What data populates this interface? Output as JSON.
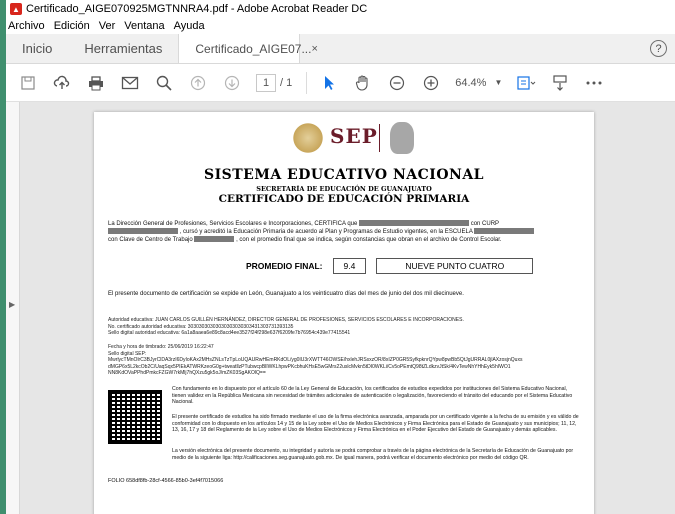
{
  "window": {
    "title": "Certificado_AIGE070925MGTNNRA4.pdf - Adobe Acrobat Reader DC",
    "app_icon": "acrobat-icon"
  },
  "menu": [
    "Archivo",
    "Edición",
    "Ver",
    "Ventana",
    "Ayuda"
  ],
  "tabs": {
    "home": "Inicio",
    "tools": "Herramientas",
    "document": "Certificado_AIGE07...",
    "close": "×",
    "help": "?"
  },
  "toolbar": {
    "icons": [
      "save-icon",
      "cloud-upload-icon",
      "print-icon",
      "email-icon",
      "search-zoom-icon",
      "page-up-icon",
      "page-down-icon",
      "select-arrow-icon",
      "hand-icon",
      "zoom-out-icon",
      "zoom-in-icon",
      "fit-page-icon",
      "scroll-mode-icon",
      "more-icon"
    ],
    "current_page": "1",
    "total_pages": "/ 1",
    "zoom": "64.4%"
  },
  "document": {
    "title": "SISTEMA EDUCATIVO NACIONAL",
    "subtitle": "SECRETARÍA DE EDUCACIÓN DE GUANAJUATO",
    "certificate_title": "CERTIFICADO DE EDUCACIÓN PRIMARIA",
    "logo_text": "SEP",
    "intro_1": "La Dirección General de Profesiones, Servicios Escolares e Incorporaciones, CERTIFICA que",
    "intro_1_end": "con CURP",
    "intro_2": ", cursó y acreditó la Educación Primaria de acuerdo al Plan y Programas de Estudio vigentes, en la ESCUELA",
    "intro_3a": "con Clave de Centro de Trabajo",
    "intro_3b": ", con el promedio final que se indica, según constancias que obran en el archivo de Control Escolar.",
    "promedio_label": "PROMEDIO FINAL:",
    "promedio_value": "9.4",
    "promedio_words": "NUEVE PUNTO CUATRO",
    "issued": "El presente documento de certificación se expide en León, Guanajuato a los veinticuatro días del mes de junio del dos mil diecinueve.",
    "authority_1": "Autoridad educativa: JUAN CARLOS GUILLÉN HERNÁNDEZ, DIRECTOR GENERAL DE PROFESIONES, SERVICIOS ESCOLARES E INCORPORACIONES.",
    "authority_2": "No. certificado autoridad educativa: 30303030303030303030303431303731393135",
    "authority_3": "Sello digital autoridad educativa: 6a1a8aaea6e89c8acd4ee3527f24f298e637f6209fe7b76954c439e77415541",
    "timestamp": "Fecha y hora de timbrado: 25/06/2019 16:22:47",
    "sello_label": "Sello digital SEP:",
    "sello_1": "MwrlycTMnOlrC3BJyrClDA3rzI6DyIoKAx2MHsZNLsTzTpLoUQAURwHEmRKdOL/yg0IU3rXWTT46OWSE/hxlehJRSsxzOR/8xIZP0GR5SyfkpknrQYpw8pwBb5QtJgURRAL0jlAXzosjnQuxs",
    "sello_2": "dMGP6x5L2kcOb2C/UaqSqx5PIEkATWRKzeoG0g+tweatllzPTubwcpBlIWKLhpwPKcbhuKHsE5wGMrs22uslcMvkn5tDI0WKLi/Cv5oPEmtQ98tZLdkzvJtSk/4KvTewNhYHhEyk5hIWO1",
    "sello_3": "NN8KdOVaPPhdPmkcFZGW7rkMlj7hQXzu5gk5oJ/mZK03SgAKOlQ==",
    "qr_1": "Con fundamento en lo dispuesto por el artículo 60 de la Ley General de Educación, los certificados de estudios expedidos por instituciones del Sistema Educativo Nacional, tienen validez en la República Mexicana sin necesidad de trámites adicionales de autenticación o legalización, favoreciendo el tránsito del educando por el Sistema Educativo Nacional.",
    "qr_2": "El presente certificado de estudios ha sido firmado mediante el uso de la firma electrónica avanzada, amparada por un certificado vigente a la fecha de su emisión y es válido de conformidad con lo dispuesto en los artículos 14 y 15 de la Ley sobre el Uso de Medios Electrónicos y Firma Electrónica para el Estado de Guanajuato y sus municipios; 11, 12, 13, 16, 17 y 18 del Reglamento de la Ley sobre el Uso de Medios Electrónicos y Firma Electrónica en el Poder Ejecutivo del Estado de Guanajuato y demás aplicables.",
    "qr_3": "La versión electrónica del presente documento, su integridad y autoría se podrá comprobar a través de la página electrónica de la Secretaría de Educación de Guanajuato por medio de la siguiente liga: http://calificaciones.seg.guanajuato.gob.mx. De igual manera, podrá verificar el documento electrónico por medio del código QR.",
    "folio": "FOLIO 658df8fb-28cf-4566-85b0-3ef4f7015066"
  }
}
